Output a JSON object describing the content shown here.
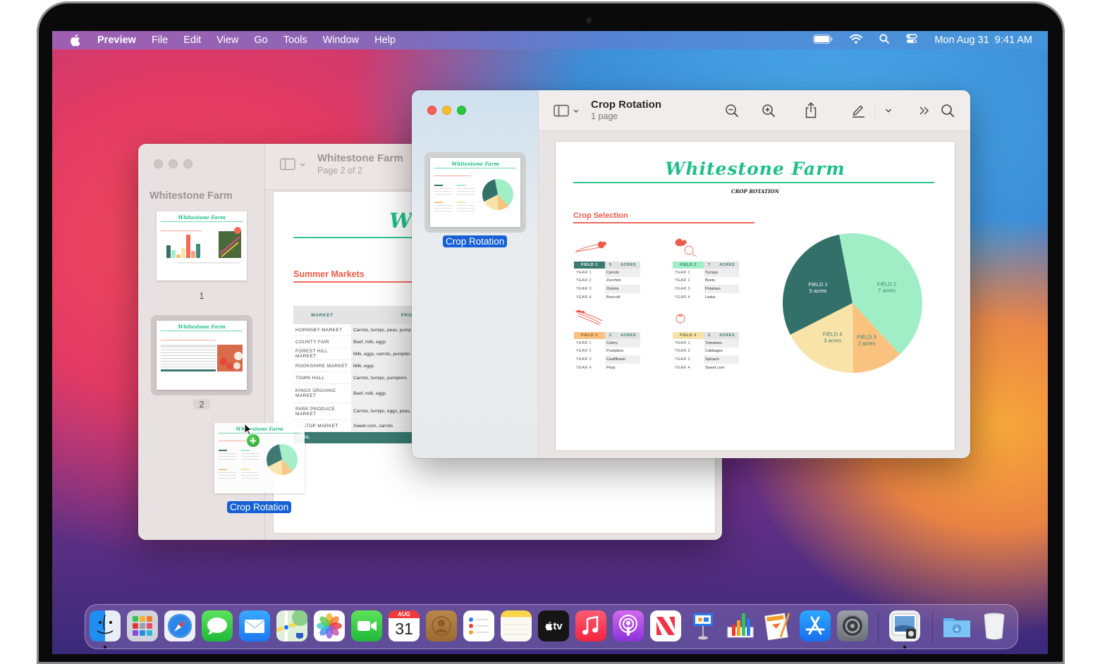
{
  "menubar": {
    "app_name": "Preview",
    "items": [
      "File",
      "Edit",
      "View",
      "Go",
      "Tools",
      "Window",
      "Help"
    ],
    "status_icons": [
      "battery-icon",
      "wifi-icon",
      "spotlight-search-icon",
      "control-center-icon"
    ],
    "clock": "Mon Aug 31  9:41 AM"
  },
  "back_window": {
    "sidebar_title": "Whitestone Farm",
    "toolbar_title": "Whitestone Farm",
    "toolbar_subtitle": "Page 2 of 2",
    "pages": [
      {
        "number": "1",
        "title": "Whitestone Farm",
        "selected": false
      },
      {
        "number": "2",
        "title": "Whitestone Farm",
        "selected": true
      }
    ],
    "document": {
      "title": "Whitestone Farm",
      "section": "Summer Markets",
      "columns": [
        "MARKET",
        "PRODUCE"
      ],
      "rows": [
        {
          "market": "HORNSBY MARKET",
          "produce": "Carrots, turnips, peas, pump"
        },
        {
          "market": "COUNTY FAIR",
          "produce": "Beef, milk, eggs"
        },
        {
          "market": "FOREST HILL MARKET",
          "produce": "Milk, eggs, carrots, pumpkin"
        },
        {
          "market": "ROOKSHIRE MARKET",
          "produce": "Milk, eggs"
        },
        {
          "market": "TOWN HALL",
          "produce": "Carrots, turnips, pumpkins"
        },
        {
          "market": "KINGS ORGANIC MARKET",
          "produce": "Beef, milk, eggs"
        },
        {
          "market": "PARK PRODUCE MARKET",
          "produce": "Carrots, turnips, eggs, peas, pumpkins"
        },
        {
          "market": "HILLTOP MARKET",
          "produce": "Sweet corn, carrots"
        }
      ],
      "total_label": "TOTAL"
    },
    "dragged_page_label": "Crop Rotation"
  },
  "front_window": {
    "toolbar_title": "Crop Rotation",
    "toolbar_subtitle": "1 page",
    "thumbnail_label": "Crop Rotation",
    "toolbar_icons": [
      "sidebar-toggle-icon",
      "zoom-out-icon",
      "zoom-in-icon",
      "share-icon",
      "markup-pen-icon",
      "chevron-down-icon",
      "more-chevrons-icon",
      "search-icon"
    ],
    "document": {
      "title": "Whitestone Farm",
      "subtitle": "CROP ROTATION",
      "section": "Crop Selection",
      "fields": [
        {
          "name": "FIELD 1",
          "acres": "5",
          "acres_label": "ACRES",
          "color": "#3a7a70",
          "text_color": "#ffffff",
          "icon": "carrot-icon",
          "years": [
            [
              "YEAR 1",
              "Carrots"
            ],
            [
              "YEAR 2",
              "Zucchini"
            ],
            [
              "YEAR 3",
              "Onions"
            ],
            [
              "YEAR 4",
              "Broccoli"
            ]
          ]
        },
        {
          "name": "FIELD 2",
          "acres": "7",
          "acres_label": "ACRES",
          "color": "#9eeec6",
          "text_color": "#3a7a70",
          "icon": "turnip-icon",
          "years": [
            [
              "YEAR 1",
              "Turnips"
            ],
            [
              "YEAR 2",
              "Beets"
            ],
            [
              "YEAR 3",
              "Potatoes"
            ],
            [
              "YEAR 4",
              "Leeks"
            ]
          ]
        },
        {
          "name": "FIELD 3",
          "acres": "2",
          "acres_label": "ACRES",
          "color": "#f9c27e",
          "text_color": "#8a5a2a",
          "icon": "celery-icon",
          "years": [
            [
              "YEAR 1",
              "Celery"
            ],
            [
              "YEAR 2",
              "Pumpkins"
            ],
            [
              "YEAR 3",
              "Cauliflower"
            ],
            [
              "YEAR 4",
              "Peas"
            ]
          ]
        },
        {
          "name": "FIELD 4",
          "acres": "3",
          "acres_label": "ACRES",
          "color": "#f7e3a8",
          "text_color": "#6a6a3a",
          "icon": "tomato-icon",
          "years": [
            [
              "YEAR 1",
              "Tomatoes"
            ],
            [
              "YEAR 2",
              "Cabbages"
            ],
            [
              "YEAR 3",
              "Spinach"
            ],
            [
              "YEAR 4",
              "Sweet corn"
            ]
          ]
        }
      ]
    }
  },
  "chart_data": {
    "type": "pie",
    "title": "",
    "categories": [
      "FIELD 1",
      "FIELD 2",
      "FIELD 3",
      "FIELD 4"
    ],
    "values": [
      5,
      7,
      2,
      3
    ],
    "labels": [
      "5 acres",
      "7 acres",
      "2 acres",
      "3 acres"
    ],
    "colors": [
      "#33706a",
      "#a0eec6",
      "#f9c27e",
      "#f8e3a8"
    ],
    "label_colors": [
      "#ffffff",
      "#3a7a70",
      "#3a7a70",
      "#3a7a70"
    ],
    "legend": "none"
  },
  "dock": {
    "apps": [
      "Finder",
      "Launchpad",
      "Safari",
      "Messages",
      "Mail",
      "Maps",
      "Photos",
      "FaceTime",
      "Calendar",
      "Contacts",
      "Reminders",
      "Notes",
      "Apple TV",
      "Music",
      "Podcasts",
      "News",
      "Keynote",
      "Numbers",
      "Pages",
      "App Store",
      "System Preferences",
      "Preview",
      "Downloads",
      "Trash"
    ],
    "calendar_month": "AUG",
    "calendar_day": "31",
    "tv_label": "tv"
  }
}
